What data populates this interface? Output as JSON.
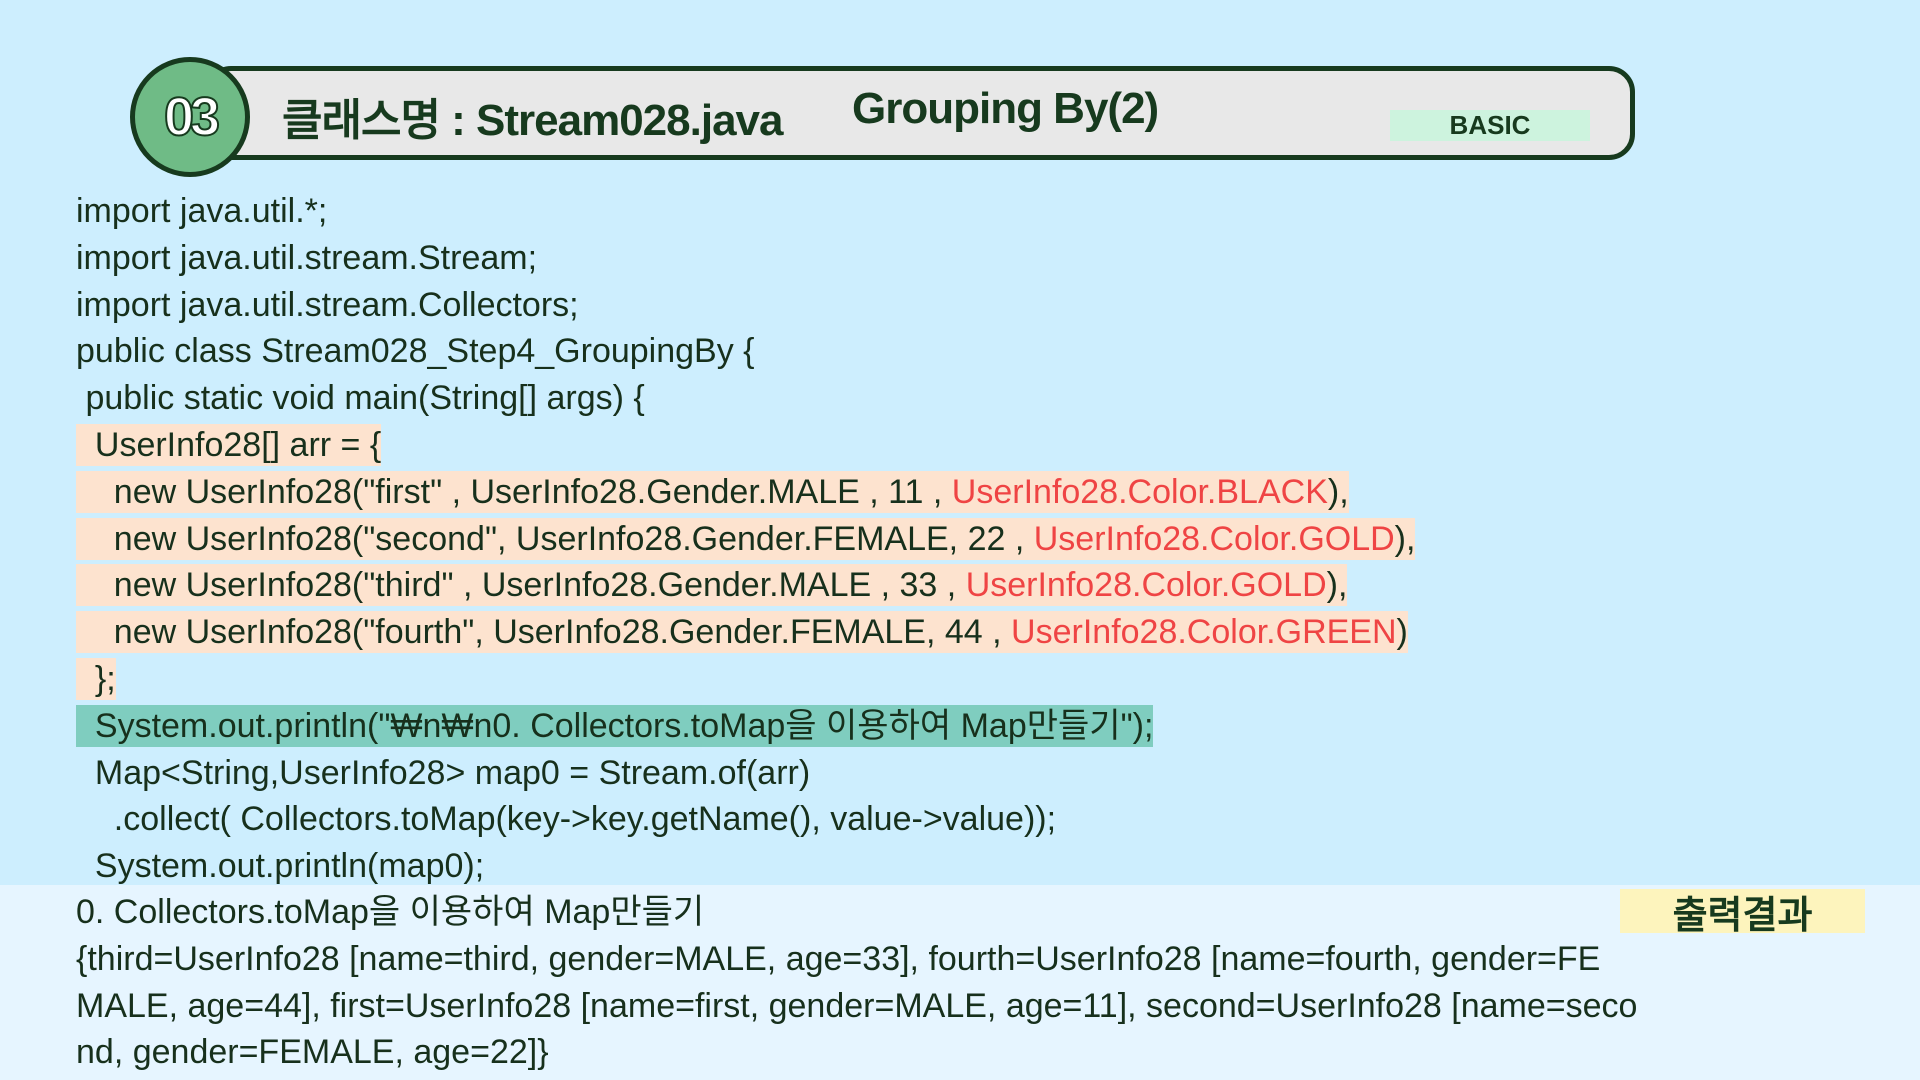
{
  "header": {
    "number": "03",
    "class_label": "클래스명 : Stream028.java",
    "topic": "Grouping By(2)",
    "level": "BASIC"
  },
  "code": {
    "lines": [
      "import java.util.*;",
      "import java.util.stream.Stream;",
      "import java.util.stream.Collectors;",
      "public class Stream028_Step4_GroupingBy {",
      " public static void main(String[] args) {",
      "  UserInfo28[] arr = {",
      "    new UserInfo28(\"first\" , UserInfo28.Gender.MALE , 11 , ",
      "    new UserInfo28(\"second\", UserInfo28.Gender.FEMALE, 22 , ",
      "    new UserInfo28(\"third\" , UserInfo28.Gender.MALE , 33 , ",
      "    new UserInfo28(\"fourth\", UserInfo28.Gender.FEMALE, 44 , ",
      "  };",
      "  System.out.println(\"₩n₩n0. Collectors.toMap을 이용하여 Map만들기\");",
      "  Map<String,UserInfo28> map0 = Stream.of(arr)",
      "    .collect( Collectors.toMap(key->key.getName(), value->value));",
      "  System.out.println(map0);"
    ],
    "colors": [
      "UserInfo28.Color.BLACK",
      "UserInfo28.Color.GOLD",
      "UserInfo28.Color.GOLD",
      "UserInfo28.Color.GREEN"
    ],
    "tails": [
      "),",
      "),",
      "),",
      ")"
    ]
  },
  "output": {
    "label": "출력결과",
    "lines": [
      "0. Collectors.toMap을 이용하여 Map만들기",
      "{third=UserInfo28 [name=third, gender=MALE, age=33], fourth=UserInfo28 [name=fourth, gender=FE",
      "MALE, age=44], first=UserInfo28 [name=first, gender=MALE, age=11], second=UserInfo28 [name=seco",
      "nd, gender=FEMALE, age=22]}"
    ]
  },
  "colors": {
    "background": "#cdeefe",
    "highlight": "#fde3cf",
    "highlight_print": "#7fcdbf",
    "red": "#ef4444",
    "badge": "#6fbb86"
  }
}
